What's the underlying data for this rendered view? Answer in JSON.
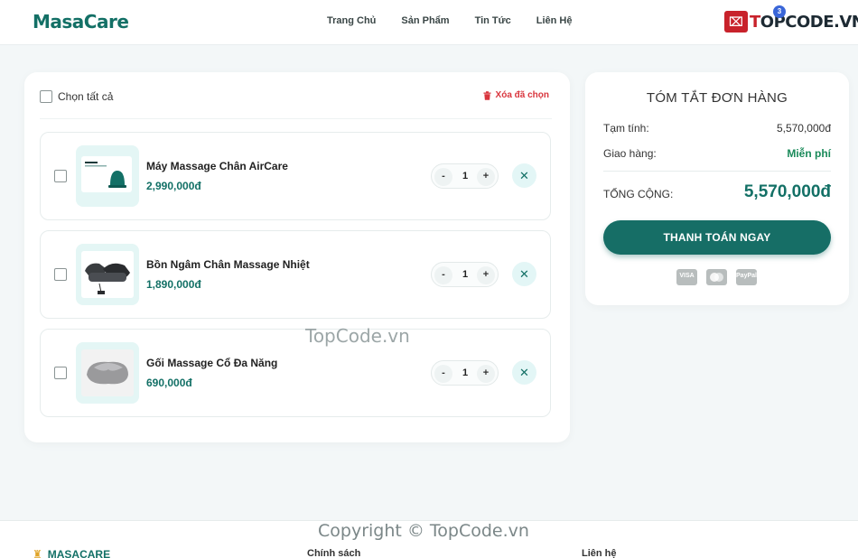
{
  "header": {
    "logo": "MasaCare",
    "nav": [
      "Trang Chủ",
      "Sản Phẩm",
      "Tin Tức",
      "Liên Hệ"
    ],
    "brand_name_prefix": "T",
    "brand_name_rest": "OPCODE.VN",
    "cart_count": "3"
  },
  "cart": {
    "select_all_label": "Chọn tất cả",
    "delete_selected_label": "Xóa đã chọn",
    "items": [
      {
        "name": "Máy Massage Chân AirCare",
        "price": "2,990,000đ",
        "quantity": "1"
      },
      {
        "name": "Bồn Ngâm Chân Massage Nhiệt",
        "price": "1,890,000đ",
        "quantity": "1"
      },
      {
        "name": "Gối Massage Cổ Đa Năng",
        "price": "690,000đ",
        "quantity": "1"
      }
    ],
    "minus_label": "-",
    "plus_label": "+",
    "remove_label": "✕"
  },
  "summary": {
    "title": "TÓM TẮT ĐƠN HÀNG",
    "subtotal_label": "Tạm tính:",
    "subtotal_value": "5,570,000đ",
    "shipping_label": "Giao hàng:",
    "shipping_value": "Miễn phí",
    "total_label": "TỔNG CỘNG:",
    "total_value": "5,570,000đ",
    "checkout_label": "THANH TOÁN NGAY",
    "payment_methods": [
      "VISA",
      "",
      "PayPal"
    ]
  },
  "watermark": "TopCode.vn",
  "footer": {
    "copyright": "Copyright © TopCode.vn",
    "brand": "MASACARE",
    "col1": "Chính sách",
    "col2": "Liên hệ"
  },
  "colors": {
    "accent": "#137066",
    "danger": "#d9363e",
    "free": "#1a8a5a"
  }
}
